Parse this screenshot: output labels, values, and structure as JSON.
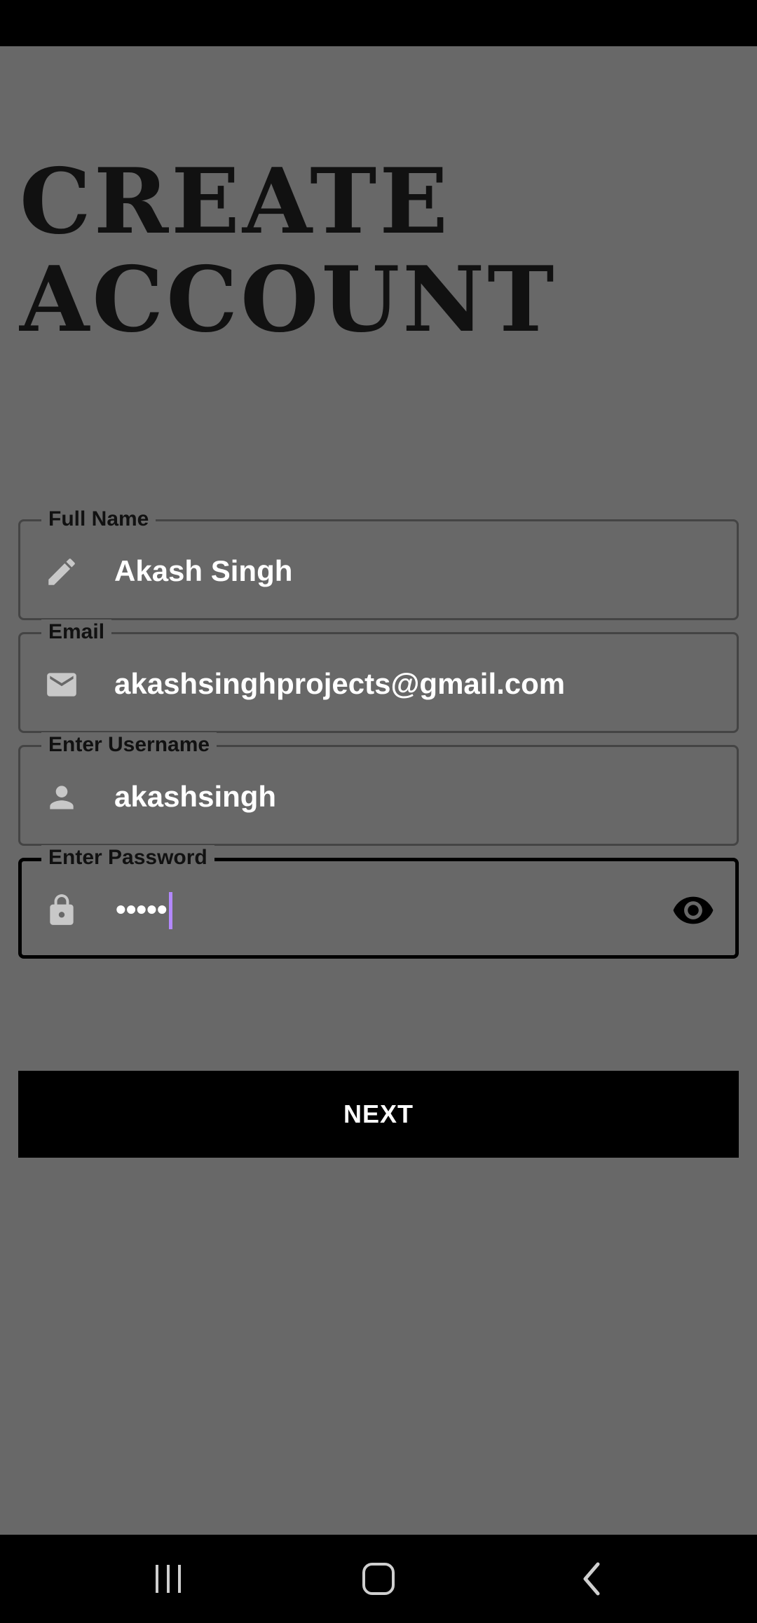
{
  "title_lines": [
    "CREATE",
    "ACCOUNT"
  ],
  "fields": [
    {
      "label": "Full Name",
      "value": "Akash Singh",
      "icon": "pencil-icon"
    },
    {
      "label": "Email",
      "value": "akashsinghprojects@gmail.com",
      "icon": "mail-icon"
    },
    {
      "label": "Enter Username",
      "value": "akashsingh",
      "icon": "person-icon"
    },
    {
      "label": "Enter Password",
      "value": "•••••",
      "icon": "lock-icon",
      "trailing_icon": "eye-icon",
      "focused": true
    }
  ],
  "next_label": "NEXT",
  "colors": {
    "background": "#686868",
    "system_bars": "#000000",
    "field_text": "#ffffff",
    "label_text": "#111111",
    "caret": "#b388ff",
    "icon_gray": "#c8c8c8"
  }
}
